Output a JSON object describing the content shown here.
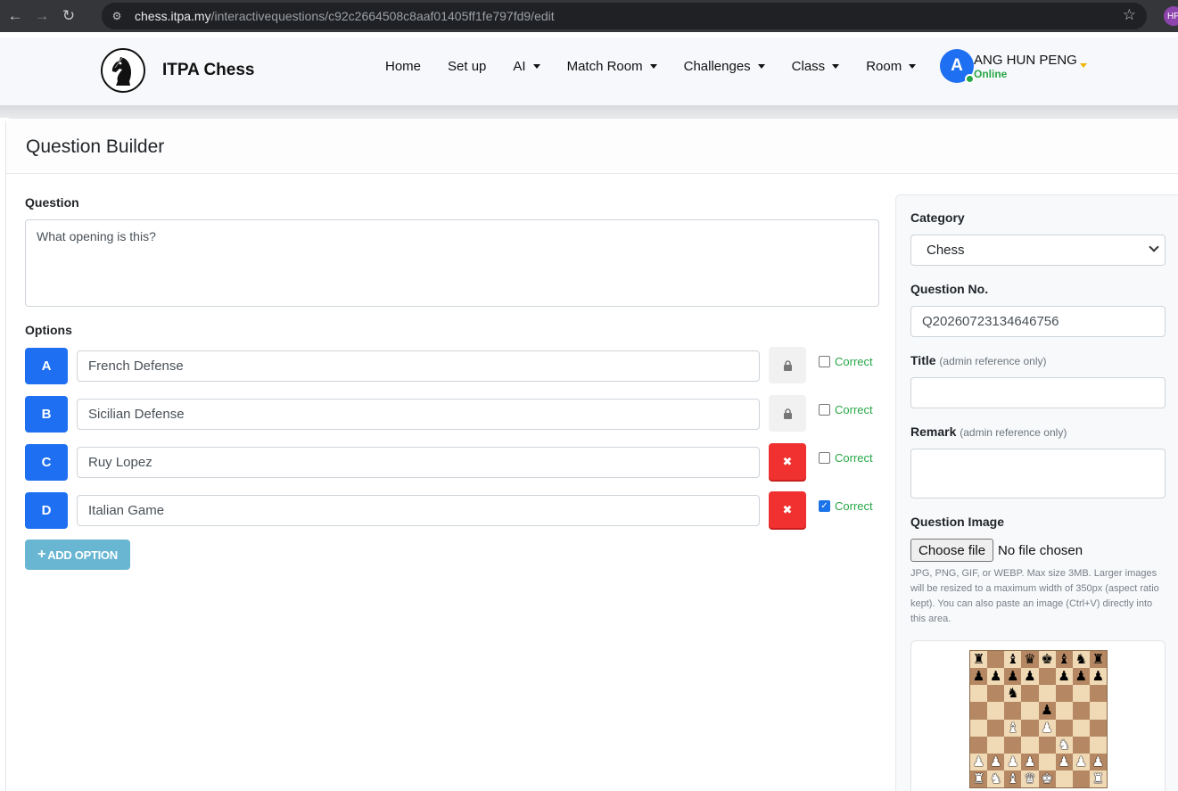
{
  "browser": {
    "url_host": "chess.itpa.my",
    "url_path": "/interactivequestions/c92c2664508c8aaf01405ff1fe797fd9/edit",
    "profile_initials": "HP"
  },
  "nav": {
    "brand": "ITPA Chess",
    "items": [
      "Home",
      "Set up",
      "AI",
      "Match Room",
      "Challenges",
      "Class",
      "Room"
    ],
    "dropdown_flags": [
      false,
      false,
      true,
      true,
      true,
      true,
      true
    ],
    "user": {
      "initial": "A",
      "name": "ANG HUN PENG",
      "status": "Online"
    }
  },
  "page": {
    "title": "Question Builder"
  },
  "form": {
    "question_label": "Question",
    "question_value": "What opening is this?",
    "options_label": "Options",
    "options": [
      {
        "letter": "A",
        "value": "French Defense",
        "action": "lock",
        "correct": false
      },
      {
        "letter": "B",
        "value": "Sicilian Defense",
        "action": "lock",
        "correct": false
      },
      {
        "letter": "C",
        "value": "Ruy Lopez",
        "action": "delete",
        "correct": false
      },
      {
        "letter": "D",
        "value": "Italian Game",
        "action": "delete",
        "correct": true
      }
    ],
    "correct_label": "Correct",
    "add_option_label": "ADD OPTION"
  },
  "side": {
    "category_label": "Category",
    "category_value": "Chess",
    "question_no_label": "Question No.",
    "question_no_value": "Q20260723134646756",
    "title_label": "Title",
    "title_hint": "(admin reference only)",
    "title_value": "",
    "remark_label": "Remark",
    "remark_hint": "(admin reference only)",
    "remark_value": "",
    "image_label": "Question Image",
    "file_button": "Choose file",
    "file_status": "No file chosen",
    "help_text": "JPG, PNG, GIF, or WEBP. Max size 3MB. Larger images will be resized to a maximum width of 350px (aspect ratio kept). You can also paste an image (Ctrl+V) directly into this area."
  },
  "board": {
    "rows": [
      "r.bqkbnr",
      "pppp.ppp",
      "..n.....",
      "....p...",
      "..B.P...",
      ".....N..",
      "PPPP.PPP",
      "RNBQK..R"
    ]
  },
  "colors": {
    "primary": "#1e6ff1",
    "danger": "#f0312f",
    "success": "#28a745",
    "info": "#69b6d3",
    "board_light": "#f0d9b5",
    "board_dark": "#b58863"
  }
}
